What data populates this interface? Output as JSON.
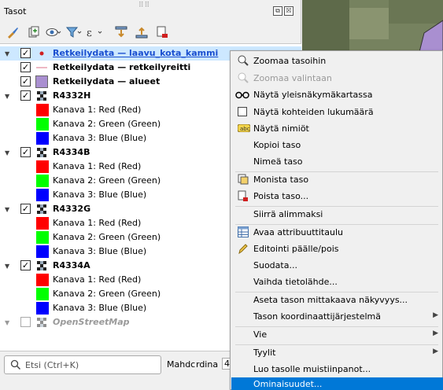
{
  "panel": {
    "title": "Tasot",
    "float_icon": "⧉",
    "close_icon": "☒"
  },
  "toolbar": [
    {
      "name": "style-brush-icon"
    },
    {
      "name": "add-group-icon"
    },
    {
      "name": "eye-visibility-icon"
    },
    {
      "name": "filter-icon"
    },
    {
      "name": "expression-filter-icon"
    },
    {
      "name": "expand-all-icon"
    },
    {
      "name": "collapse-all-icon"
    },
    {
      "name": "remove-layer-icon"
    }
  ],
  "layers": [
    {
      "label": "Retkeilydata — laavu_kota_kammi",
      "checked": true,
      "selected": true
    },
    {
      "label": "Retkeilydata — retkeilyreitti",
      "checked": true
    },
    {
      "label": "Retkeilydata — alueet",
      "checked": true
    },
    {
      "label": "R4332H",
      "checked": true
    },
    {
      "label": "Kanava 1: Red (Red)"
    },
    {
      "label": "Kanava 2: Green (Green)"
    },
    {
      "label": "Kanava 3: Blue (Blue)"
    },
    {
      "label": "R4334B",
      "checked": true
    },
    {
      "label": "Kanava 1: Red (Red)"
    },
    {
      "label": "Kanava 2: Green (Green)"
    },
    {
      "label": "Kanava 3: Blue (Blue)"
    },
    {
      "label": "R4332G",
      "checked": true
    },
    {
      "label": "Kanava 1: Red (Red)"
    },
    {
      "label": "Kanava 2: Green (Green)"
    },
    {
      "label": "Kanava 3: Blue (Blue)"
    },
    {
      "label": "R4334A",
      "checked": true
    },
    {
      "label": "Kanava 1: Red (Red)"
    },
    {
      "label": "Kanava 2: Green (Green)"
    },
    {
      "label": "Kanava 3: Blue (Blue)"
    },
    {
      "label": "OpenStreetMap",
      "checked": false
    }
  ],
  "colors": {
    "red": "#ff0000",
    "green": "#00ff00",
    "blue": "#0000ff",
    "polygon": "#a98fd0",
    "highlight": "#0078d7",
    "selected_row": "#cde8ff"
  },
  "search": {
    "placeholder": "Etsi (Ctrl+K)"
  },
  "status": {
    "label1": "Mahdc",
    "label2": "rdina",
    "value": "46"
  },
  "menu": [
    {
      "label": "Zoomaa tasoihin",
      "icon": "zoom-icon"
    },
    {
      "label": "Zoomaa valintaan",
      "icon": "zoom-selection-icon",
      "disabled": true
    },
    {
      "label": "Näytä yleisnäkymäkartassa",
      "icon": "glasses-icon"
    },
    {
      "label": "Näytä kohteiden lukumäärä",
      "icon": "checkbox-icon"
    },
    {
      "label": "Näytä nimiöt",
      "icon": "label-icon"
    },
    {
      "label": "Kopioi taso"
    },
    {
      "label": "Nimeä taso"
    },
    {
      "label": "Monista taso",
      "icon": "duplicate-icon"
    },
    {
      "label": "Poista taso...",
      "icon": "remove-icon"
    },
    {
      "label": "Siirrä alimmaksi"
    },
    {
      "label": "Avaa attribuuttitaulu",
      "icon": "table-icon"
    },
    {
      "label": "Editointi päälle/pois",
      "icon": "pencil-icon"
    },
    {
      "label": "Suodata..."
    },
    {
      "label": "Vaihda tietolähde..."
    },
    {
      "label": "Aseta tason mittakaava näkyvyys..."
    },
    {
      "label": "Tason koordinaattijärjestelmä",
      "submenu": true
    },
    {
      "label": "Vie",
      "submenu": true
    },
    {
      "label": "Tyylit",
      "submenu": true
    },
    {
      "label": "Luo tasolle muistiinpanot..."
    },
    {
      "label": "Ominaisuudet...",
      "highlighted": true
    }
  ]
}
